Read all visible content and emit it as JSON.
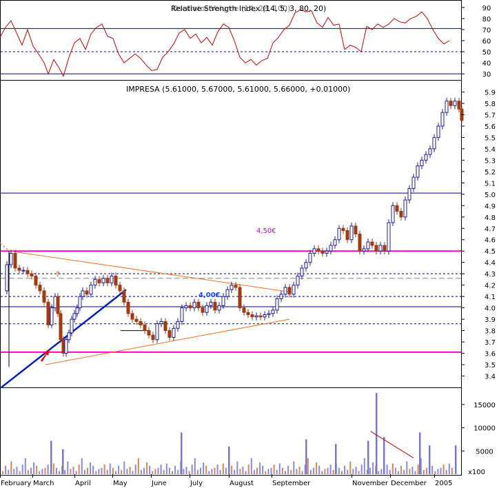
{
  "chart_data": [
    {
      "type": "line",
      "panel": "indicator",
      "title": "Relative Strength Index (14, 5, 3, 80, 20)",
      "title_overlap": "Oscillator Volume (14, 28, 100)",
      "ylim": [
        27,
        93
      ],
      "yticks": [
        30,
        40,
        50,
        60,
        70,
        80,
        90
      ],
      "reference_lines": [
        {
          "value": 71,
          "style": "solid",
          "color": "#0000aa"
        },
        {
          "value": 50,
          "style": "dashed",
          "color": "#0000aa"
        },
        {
          "value": 30,
          "style": "solid",
          "color": "#0000aa"
        }
      ],
      "series": [
        {
          "color": "#cc0000",
          "points": [
            [
              0,
              63
            ],
            [
              8,
              72
            ],
            [
              16,
              78
            ],
            [
              24,
              67
            ],
            [
              32,
              56
            ],
            [
              40,
              70
            ],
            [
              48,
              55
            ],
            [
              56,
              48
            ],
            [
              64,
              40
            ],
            [
              70,
              30
            ],
            [
              78,
              43
            ],
            [
              86,
              35
            ],
            [
              92,
              28
            ],
            [
              100,
              45
            ],
            [
              108,
              58
            ],
            [
              116,
              62
            ],
            [
              124,
              52
            ],
            [
              132,
              66
            ],
            [
              140,
              72
            ],
            [
              148,
              75
            ],
            [
              156,
              64
            ],
            [
              164,
              62
            ],
            [
              172,
              48
            ],
            [
              180,
              40
            ],
            [
              188,
              44
            ],
            [
              196,
              48
            ],
            [
              204,
              44
            ],
            [
              212,
              38
            ],
            [
              220,
              33
            ],
            [
              228,
              34
            ],
            [
              236,
              45
            ],
            [
              244,
              50
            ],
            [
              252,
              57
            ],
            [
              260,
              67
            ],
            [
              268,
              70
            ],
            [
              276,
              62
            ],
            [
              284,
              66
            ],
            [
              292,
              58
            ],
            [
              300,
              63
            ],
            [
              308,
              56
            ],
            [
              316,
              68
            ],
            [
              324,
              75
            ],
            [
              332,
              72
            ],
            [
              340,
              60
            ],
            [
              348,
              45
            ],
            [
              356,
              40
            ],
            [
              364,
              43
            ],
            [
              372,
              38
            ],
            [
              380,
              42
            ],
            [
              388,
              44
            ],
            [
              396,
              58
            ],
            [
              404,
              63
            ],
            [
              412,
              70
            ],
            [
              420,
              74
            ],
            [
              428,
              85
            ],
            [
              436,
              88
            ],
            [
              444,
              86
            ],
            [
              452,
              87
            ],
            [
              460,
              76
            ],
            [
              468,
              72
            ],
            [
              476,
              81
            ],
            [
              484,
              74
            ],
            [
              492,
              75
            ],
            [
              500,
              52
            ],
            [
              508,
              56
            ],
            [
              516,
              54
            ],
            [
              524,
              50
            ],
            [
              532,
              73
            ],
            [
              540,
              70
            ],
            [
              548,
              75
            ],
            [
              556,
              72
            ],
            [
              564,
              75
            ],
            [
              572,
              80
            ],
            [
              580,
              77
            ],
            [
              588,
              76
            ],
            [
              596,
              80
            ],
            [
              604,
              82
            ],
            [
              612,
              86
            ],
            [
              620,
              80
            ],
            [
              628,
              70
            ],
            [
              636,
              62
            ],
            [
              644,
              57
            ],
            [
              652,
              60
            ]
          ]
        }
      ]
    },
    {
      "type": "candlestick",
      "panel": "price",
      "title": "IMPRESA (5.61000, 5.67000, 5.61000, 5.66000, +0.01000)",
      "ylim": [
        3.3,
        6.0
      ],
      "yticks": [
        "3.4",
        "3.5",
        "3.6",
        "3.7",
        "3.8",
        "3.9",
        "4.0",
        "4.1",
        "4.2",
        "4.3",
        "4.4",
        "4.5",
        "4.6",
        "4.7",
        "4.8",
        "4.9",
        "5.0",
        "5.1",
        "5.2",
        "5.3",
        "5.4",
        "5.5",
        "5.6",
        "5.7",
        "5.8",
        "5.9"
      ],
      "xticks": [
        "February",
        "March",
        "April",
        "May",
        "June",
        "July",
        "August",
        "September",
        "November",
        "December",
        "2005"
      ],
      "horizontal_lines": [
        {
          "value": 5.01,
          "style": "solid",
          "color": "#000080"
        },
        {
          "value": 4.5,
          "style": "solid",
          "color": "#ff00cc",
          "label": "4,50€"
        },
        {
          "value": 4.3,
          "style": "dashed",
          "color": "#000080"
        },
        {
          "value": 4.26,
          "style": "dashed",
          "color": "#808080"
        },
        {
          "value": 4.1,
          "style": "dashed",
          "color": "#000080"
        },
        {
          "value": 4.01,
          "style": "solid",
          "color": "#000080",
          "label": "4,00€"
        },
        {
          "value": 3.86,
          "style": "dashed",
          "color": "#000080"
        },
        {
          "value": 3.61,
          "style": "solid",
          "color": "#ff00cc"
        }
      ],
      "close_path": [
        [
          5,
          4.15
        ],
        [
          10,
          4.38
        ],
        [
          16,
          4.48
        ],
        [
          22,
          4.35
        ],
        [
          28,
          4.33
        ],
        [
          34,
          4.33
        ],
        [
          40,
          4.3
        ],
        [
          46,
          4.28
        ],
        [
          52,
          4.2
        ],
        [
          58,
          4.15
        ],
        [
          64,
          4.05
        ],
        [
          70,
          3.85
        ],
        [
          75,
          4.0
        ],
        [
          80,
          4.1
        ],
        [
          84,
          3.95
        ],
        [
          88,
          3.72
        ],
        [
          92,
          3.6
        ],
        [
          96,
          3.72
        ],
        [
          100,
          3.78
        ],
        [
          104,
          3.9
        ],
        [
          108,
          3.95
        ],
        [
          112,
          4.0
        ],
        [
          116,
          4.1
        ],
        [
          120,
          4.15
        ],
        [
          126,
          4.12
        ],
        [
          132,
          4.2
        ],
        [
          138,
          4.25
        ],
        [
          144,
          4.22
        ],
        [
          150,
          4.26
        ],
        [
          156,
          4.22
        ],
        [
          162,
          4.28
        ],
        [
          168,
          4.2
        ],
        [
          174,
          4.15
        ],
        [
          180,
          4.05
        ],
        [
          186,
          3.95
        ],
        [
          192,
          3.9
        ],
        [
          198,
          3.88
        ],
        [
          204,
          3.85
        ],
        [
          210,
          3.8
        ],
        [
          216,
          3.76
        ],
        [
          222,
          3.72
        ],
        [
          228,
          3.86
        ],
        [
          234,
          3.88
        ],
        [
          240,
          3.8
        ],
        [
          246,
          3.74
        ],
        [
          252,
          3.82
        ],
        [
          258,
          3.88
        ],
        [
          264,
          4.0
        ],
        [
          270,
          4.02
        ],
        [
          276,
          4.0
        ],
        [
          282,
          4.05
        ],
        [
          288,
          4.0
        ],
        [
          294,
          3.96
        ],
        [
          300,
          4.02
        ],
        [
          306,
          4.05
        ],
        [
          312,
          3.98
        ],
        [
          318,
          4.02
        ],
        [
          324,
          4.1
        ],
        [
          330,
          4.16
        ],
        [
          336,
          4.2
        ],
        [
          342,
          4.18
        ],
        [
          348,
          4.0
        ],
        [
          354,
          3.96
        ],
        [
          360,
          3.94
        ],
        [
          366,
          3.92
        ],
        [
          372,
          3.93
        ],
        [
          378,
          3.92
        ],
        [
          384,
          3.94
        ],
        [
          390,
          3.95
        ],
        [
          396,
          3.98
        ],
        [
          402,
          4.08
        ],
        [
          408,
          4.12
        ],
        [
          414,
          4.18
        ],
        [
          420,
          4.12
        ],
        [
          426,
          4.2
        ],
        [
          432,
          4.28
        ],
        [
          438,
          4.35
        ],
        [
          444,
          4.4
        ],
        [
          450,
          4.48
        ],
        [
          456,
          4.52
        ],
        [
          462,
          4.5
        ],
        [
          468,
          4.48
        ],
        [
          474,
          4.5
        ],
        [
          480,
          4.55
        ],
        [
          486,
          4.6
        ],
        [
          492,
          4.7
        ],
        [
          498,
          4.68
        ],
        [
          504,
          4.6
        ],
        [
          510,
          4.72
        ],
        [
          516,
          4.65
        ],
        [
          522,
          4.5
        ],
        [
          528,
          4.52
        ],
        [
          534,
          4.58
        ],
        [
          540,
          4.55
        ],
        [
          546,
          4.5
        ],
        [
          552,
          4.55
        ],
        [
          558,
          4.5
        ],
        [
          564,
          4.75
        ],
        [
          570,
          4.9
        ],
        [
          576,
          4.85
        ],
        [
          582,
          4.8
        ],
        [
          588,
          4.95
        ],
        [
          594,
          5.05
        ],
        [
          600,
          5.15
        ],
        [
          606,
          5.25
        ],
        [
          612,
          5.3
        ],
        [
          618,
          5.35
        ],
        [
          624,
          5.4
        ],
        [
          630,
          5.5
        ],
        [
          636,
          5.6
        ],
        [
          642,
          5.72
        ],
        [
          648,
          5.82
        ],
        [
          654,
          5.78
        ],
        [
          660,
          5.82
        ],
        [
          666,
          5.75
        ],
        [
          670,
          5.65
        ]
      ]
    },
    {
      "type": "bar",
      "panel": "volume",
      "unit_label": "x100",
      "ylim": [
        0,
        17500
      ],
      "yticks": [
        "5000",
        "10000",
        "15000"
      ],
      "values": [
        3,
        8,
        4,
        12,
        5,
        7,
        3,
        9,
        15,
        4,
        6,
        11,
        8,
        3,
        5,
        6,
        9,
        4,
        10,
        6,
        3,
        8,
        4,
        12,
        5,
        7,
        3,
        9,
        15,
        4,
        6,
        11,
        8,
        3,
        5,
        6,
        9,
        4,
        10,
        6,
        3,
        8,
        4,
        12,
        5,
        7,
        3,
        9,
        15,
        4,
        6,
        11,
        8,
        3,
        5,
        6,
        9,
        4,
        10,
        6,
        3,
        8,
        4,
        12,
        5,
        7,
        3,
        9,
        15,
        4,
        6,
        11,
        8,
        3,
        5,
        6,
        9,
        4,
        10,
        6,
        3,
        8,
        4,
        12,
        5,
        7,
        3,
        9,
        15,
        4,
        6,
        11,
        8,
        3,
        5,
        6,
        9,
        4,
        10,
        6,
        3,
        8,
        4,
        12,
        5,
        7,
        3,
        9,
        15,
        4,
        6,
        11,
        8,
        3,
        5,
        6,
        9,
        4,
        10,
        6,
        3,
        8,
        4,
        12,
        5,
        7,
        3,
        9,
        15,
        4,
        6,
        11,
        8,
        3,
        5,
        6,
        9,
        4,
        10,
        6,
        3,
        8,
        4,
        12,
        5,
        7,
        3,
        9,
        15,
        4,
        6,
        11,
        8,
        3,
        5,
        6,
        9,
        4,
        10,
        6
      ],
      "spikes": [
        {
          "x": 73,
          "value": 7200
        },
        {
          "x": 90,
          "value": 5400
        },
        {
          "x": 262,
          "value": 9000
        },
        {
          "x": 331,
          "value": 6000
        },
        {
          "x": 443,
          "value": 7500
        },
        {
          "x": 486,
          "value": 6500
        },
        {
          "x": 545,
          "value": 17500
        },
        {
          "x": 533,
          "value": 7200
        },
        {
          "x": 556,
          "value": 8000
        },
        {
          "x": 608,
          "value": 9000
        },
        {
          "x": 622,
          "value": 6200
        },
        {
          "x": 660,
          "value": 6200
        }
      ]
    }
  ],
  "annotations": [
    {
      "text": "?",
      "color": "#f07020"
    }
  ]
}
